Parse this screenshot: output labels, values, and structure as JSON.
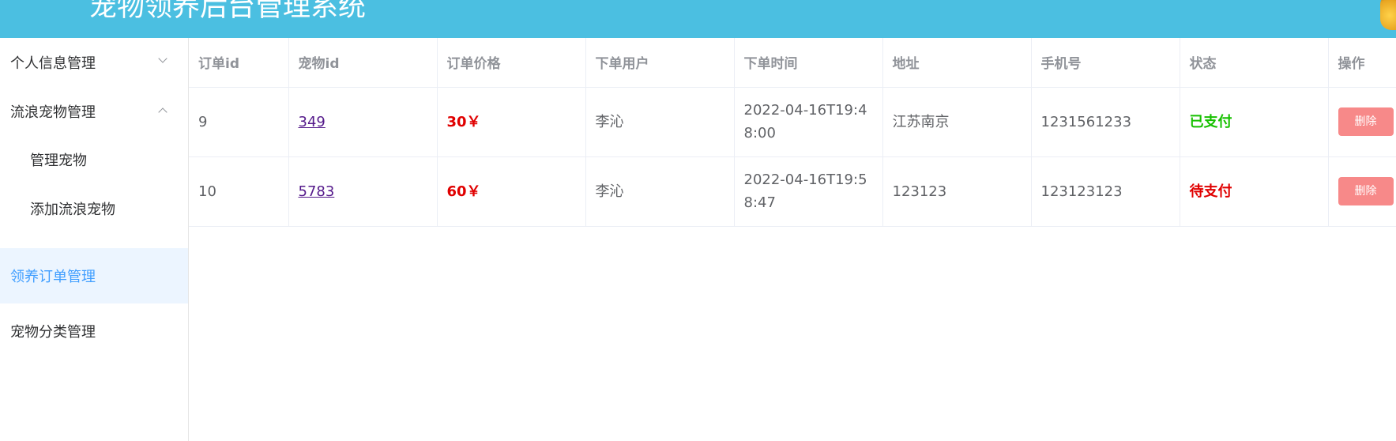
{
  "header": {
    "title": "宠物领养后台管理系统"
  },
  "sidebar": {
    "items": [
      {
        "label": "个人信息管理"
      },
      {
        "label": "流浪宠物管理"
      },
      {
        "label": "管理宠物"
      },
      {
        "label": "添加流浪宠物"
      },
      {
        "label": "领养订单管理"
      },
      {
        "label": "宠物分类管理"
      }
    ]
  },
  "table": {
    "columns": [
      "订单id",
      "宠物id",
      "订单价格",
      "下单用户",
      "下单时间",
      "地址",
      "手机号",
      "状态",
      "操作"
    ],
    "rows": [
      {
        "order_id": "9",
        "pet_id": "349",
        "price": "30￥",
        "user": "李沁",
        "time": "2022-04-16T19:48:00",
        "address": "江苏南京",
        "phone": "1231561233",
        "status": "已支付",
        "action": "删除"
      },
      {
        "order_id": "10",
        "pet_id": "5783",
        "price": "60￥",
        "user": "李沁",
        "time": "2022-04-16T19:58:47",
        "address": "123123",
        "phone": "123123123",
        "status": "待支付",
        "action": "删除"
      }
    ]
  },
  "colors": {
    "header_bg": "#4bbfe1",
    "active_menu_bg": "#ecf5ff",
    "active_menu_text": "#409eff",
    "price": "#e00000",
    "status_paid": "#17c000",
    "status_unpaid": "#e00000",
    "delete_button": "#f78989"
  }
}
